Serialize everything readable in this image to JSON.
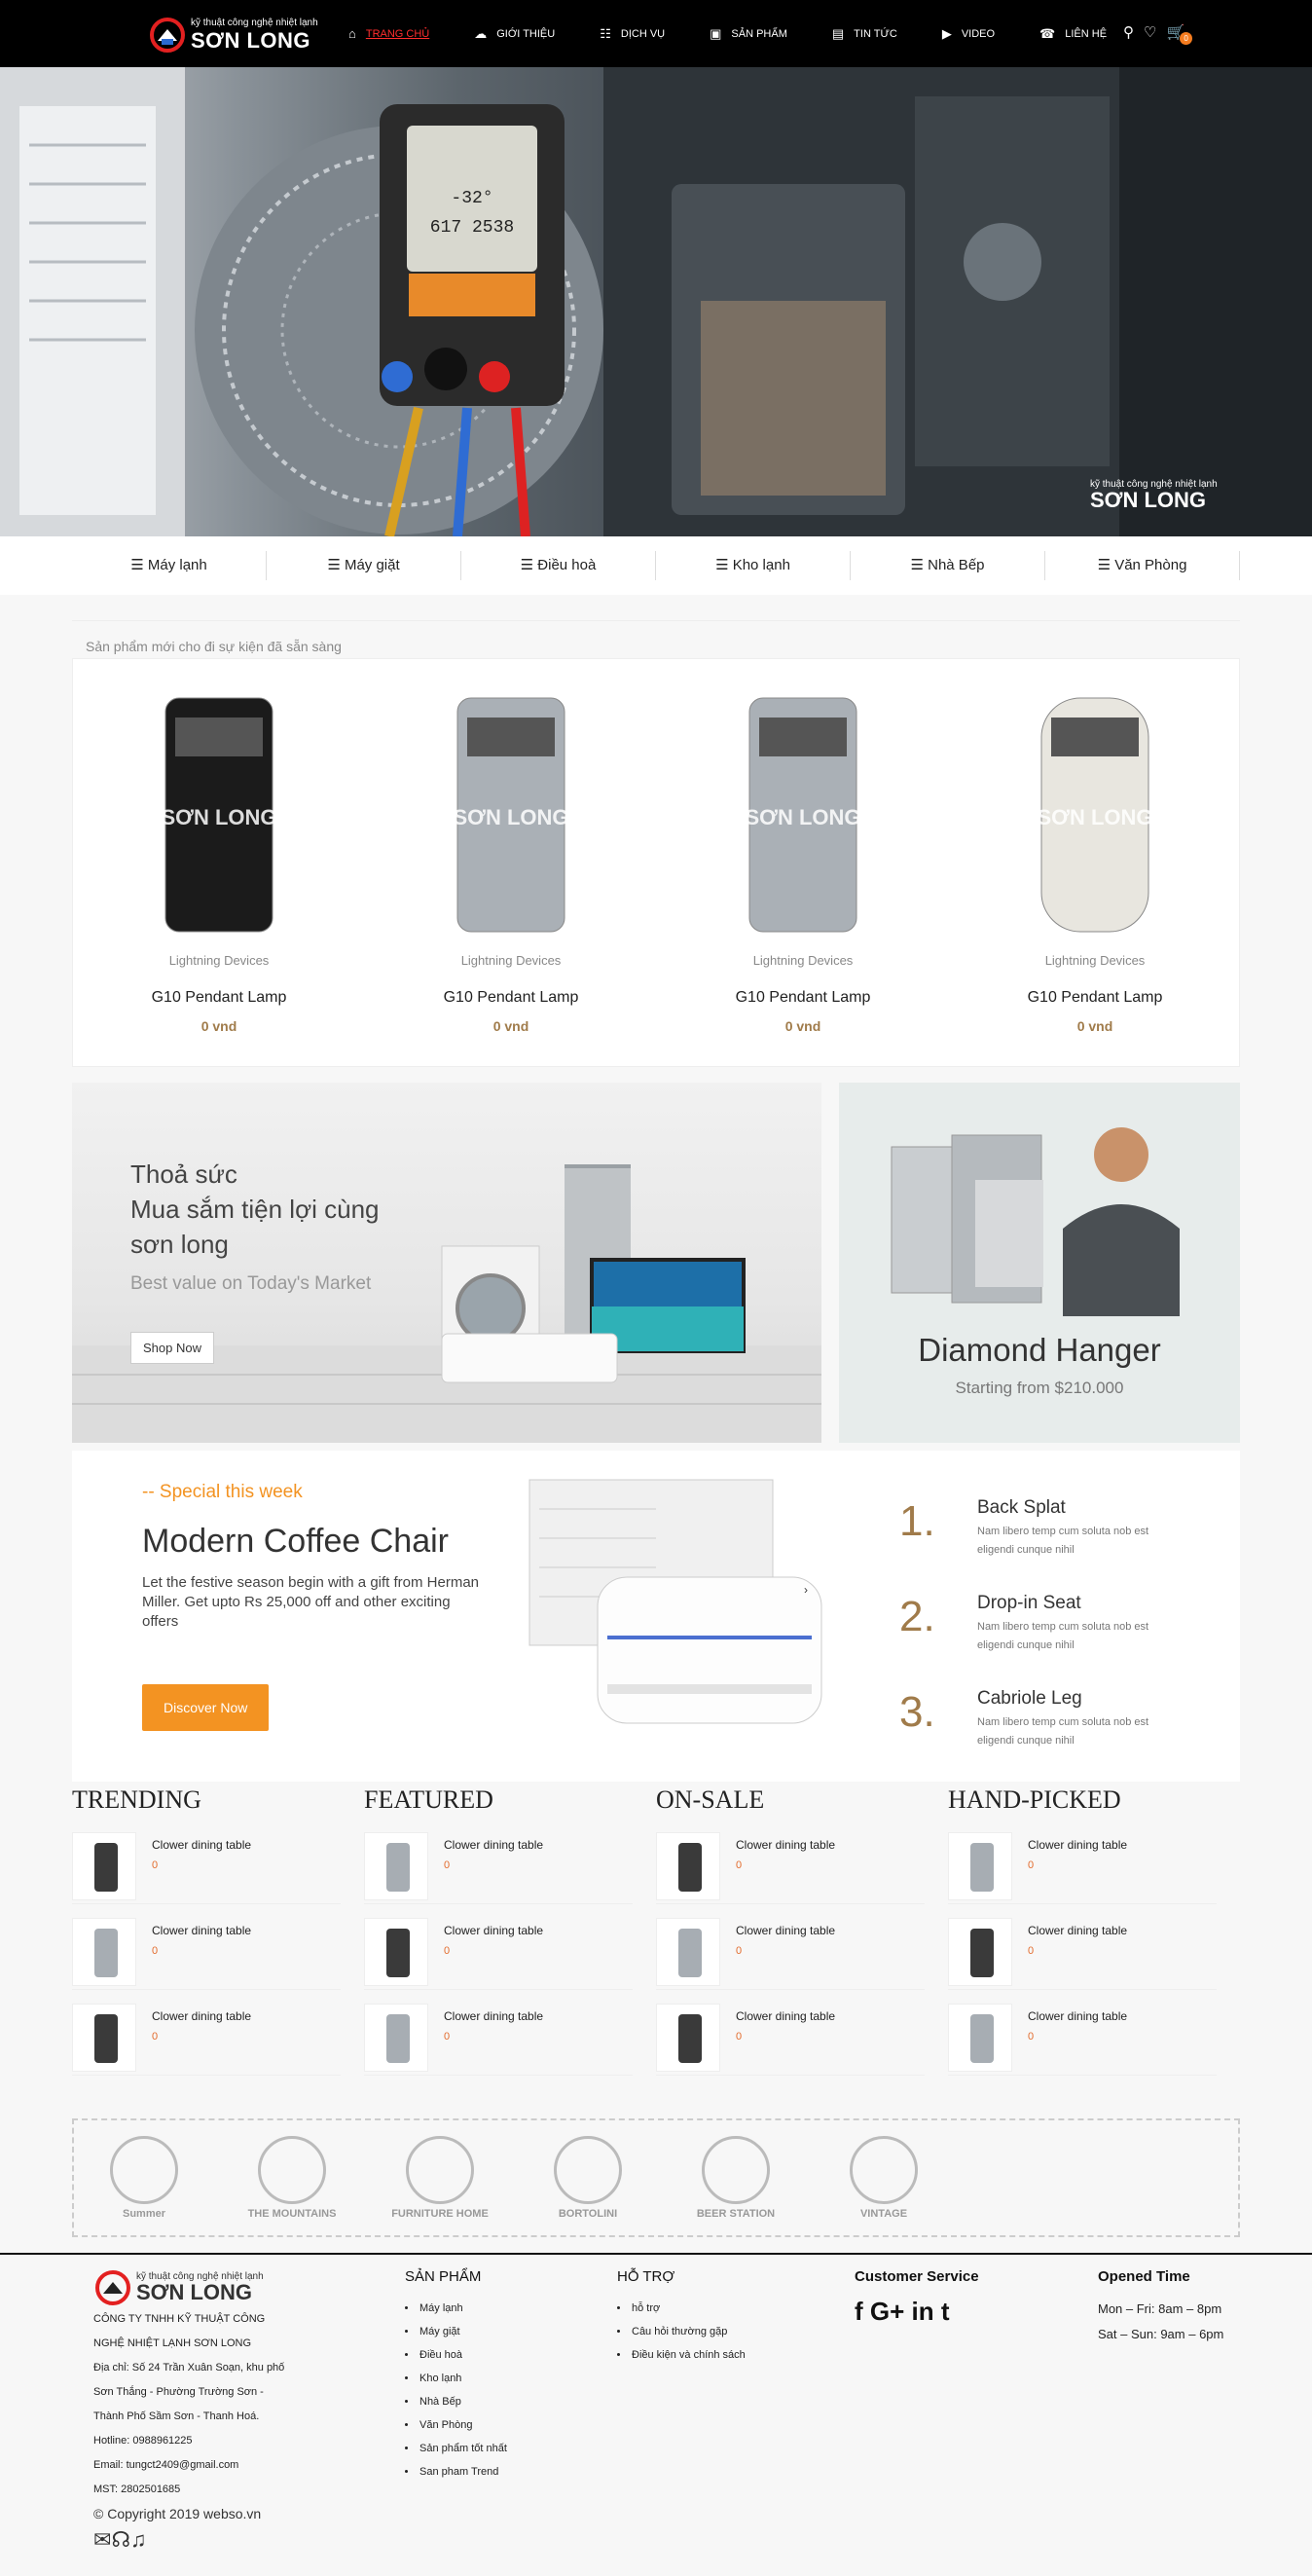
{
  "header": {
    "logo_tag": "kỹ thuật công nghệ nhiệt lạnh",
    "logo_brand": "SƠN LONG",
    "nav": [
      {
        "label": "TRANG CHỦ",
        "icon": "home-icon",
        "active": true
      },
      {
        "label": "GIỚI THIỆU",
        "icon": "cloud-icon"
      },
      {
        "label": "DỊCH VỤ",
        "icon": "service-icon"
      },
      {
        "label": "SẢN PHẨM",
        "icon": "product-icon"
      },
      {
        "label": "TIN TỨC",
        "icon": "news-icon"
      },
      {
        "label": "VIDEO",
        "icon": "video-icon"
      },
      {
        "label": "LIÊN HỆ",
        "icon": "contact-icon"
      }
    ],
    "cart_count": "0"
  },
  "hero": {
    "watermark_tag": "kỹ thuật công nghệ nhiệt lạnh",
    "watermark_brand": "SƠN LONG",
    "gauge_line1": "-32°",
    "gauge_line2": "617 2538"
  },
  "categories": [
    "Máy lạnh",
    "Máy giặt",
    "Điều hoà",
    "Kho lạnh",
    "Nhà Bếp",
    "Văn Phòng"
  ],
  "new_products": {
    "heading": "Sản phẩm mới cho đi sự kiện đã sẵn sàng",
    "items": [
      {
        "category": "Lightning Devices",
        "name": "G10 Pendant Lamp",
        "price": "0 vnd"
      },
      {
        "category": "Lightning Devices",
        "name": "G10 Pendant Lamp",
        "price": "0 vnd"
      },
      {
        "category": "Lightning Devices",
        "name": "G10 Pendant Lamp",
        "price": "0 vnd"
      },
      {
        "category": "Lightning Devices",
        "name": "G10 Pendant Lamp",
        "price": "0 vnd"
      }
    ]
  },
  "promo_left": {
    "line1": "Thoả sức",
    "line2": "Mua sắm tiện lợi cùng",
    "line3": "sơn long",
    "sub": "Best value on Today's Market",
    "button": "Shop Now"
  },
  "promo_right": {
    "title": "Diamond Hanger",
    "sub": "Starting from $210.000"
  },
  "special": {
    "kicker": "-- Special this week",
    "title": "Modern Coffee Chair",
    "desc": "Let the festive season begin with a gift from Herman Miller. Get upto Rs 25,000 off and other exciting offers",
    "button": "Discover Now",
    "items": [
      {
        "num": "1.",
        "title": "Back Splat",
        "desc": "Nam libero temp cum soluta nob est eligendi cunque nihil"
      },
      {
        "num": "2.",
        "title": "Drop-in Seat",
        "desc": "Nam libero temp cum soluta nob est eligendi cunque nihil"
      },
      {
        "num": "3.",
        "title": "Cabriole Leg",
        "desc": "Nam libero temp cum soluta nob est eligendi cunque nihil"
      }
    ]
  },
  "lists": [
    {
      "title": "TRENDING",
      "items": [
        {
          "name": "Clower dining table",
          "price": "0"
        },
        {
          "name": "Clower dining table",
          "price": "0"
        },
        {
          "name": "Clower dining table",
          "price": "0"
        }
      ]
    },
    {
      "title": "FEATURED",
      "items": [
        {
          "name": "Clower dining table",
          "price": "0"
        },
        {
          "name": "Clower dining table",
          "price": "0"
        },
        {
          "name": "Clower dining table",
          "price": "0"
        }
      ]
    },
    {
      "title": "ON-SALE",
      "items": [
        {
          "name": "Clower dining table",
          "price": "0"
        },
        {
          "name": "Clower dining table",
          "price": "0"
        },
        {
          "name": "Clower dining table",
          "price": "0"
        }
      ]
    },
    {
      "title": "HAND-PICKED",
      "items": [
        {
          "name": "Clower dining table",
          "price": "0"
        },
        {
          "name": "Clower dining table",
          "price": "0"
        },
        {
          "name": "Clower dining table",
          "price": "0"
        }
      ]
    }
  ],
  "brands": [
    "Summer",
    "THE MOUNTAINS",
    "FURNITURE HOME",
    "BORTOLINI",
    "BEER STATION",
    "VINTAGE"
  ],
  "footer": {
    "company_lines": [
      "CÔNG TY TNHH KỸ THUẬT CÔNG",
      "NGHỆ NHIỆT LẠNH SƠN LONG",
      "Địa chỉ: Số 24 Trần Xuân Soạn, khu phố",
      "Sơn Thắng - Phường Trường Sơn -",
      "Thành Phố Sầm Sơn - Thanh Hoá.",
      "Hotline: 0988961225",
      "Email: tungct2409@gmail.com",
      "MST: 2802501685"
    ],
    "copyright": "© Copyright 2019 webso.vn",
    "products_title": "SẢN PHẨM",
    "products": [
      "Máy lạnh",
      "Máy giặt",
      "Điều hoà",
      "Kho lạnh",
      "Nhà Bếp",
      "Văn Phòng",
      "Sản phẩm tốt nhất",
      "San pham Trend"
    ],
    "support_title": "HỖ TRỢ",
    "support": [
      "hỗ trợ",
      "Câu hỏi thường gặp",
      "Điều kiện và chính sách"
    ],
    "cs_title": "Customer Service",
    "social": "f G+ in t",
    "open_title": "Opened Time",
    "open_lines": [
      "Mon – Fri: 8am – 8pm",
      "Sat – Sun: 9am – 6pm"
    ]
  }
}
